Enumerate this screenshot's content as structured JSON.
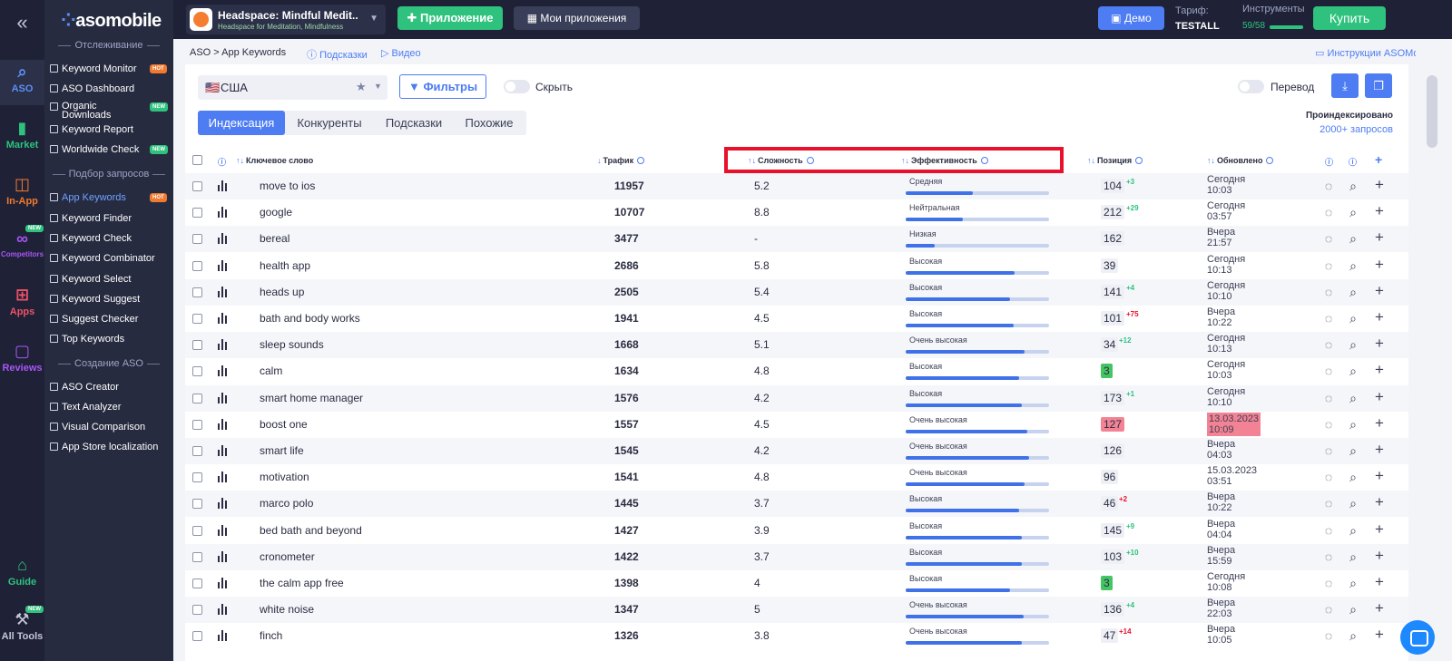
{
  "rail": {
    "items": [
      {
        "label": "ASO",
        "icon": "search-icon",
        "color": "#5b8ff7"
      },
      {
        "label": "Market",
        "icon": "bar-chart-icon",
        "color": "#2ec27e"
      },
      {
        "label": "In-App",
        "icon": "shopping-bag-icon",
        "color": "#f07a2f"
      },
      {
        "label": "Competitors",
        "icon": "binoculars-icon",
        "color": "#a855f7",
        "badge": "NEW"
      },
      {
        "label": "Apps",
        "icon": "grid-icon",
        "color": "#f0516a"
      },
      {
        "label": "Reviews",
        "icon": "chat-icon",
        "color": "#a855f7"
      },
      {
        "label": "Guide",
        "icon": "graduation-cap-icon",
        "color": "#2ec27e"
      },
      {
        "label": "All Tools",
        "icon": "tools-icon",
        "color": "#c3c7d8",
        "badge": "NEW"
      }
    ]
  },
  "sidebar": {
    "logo": "asomobile",
    "sections": [
      "Отслеживание",
      "Подбор запросов",
      "Создание ASO"
    ],
    "tracking": [
      {
        "label": "Keyword Monitor",
        "tag": "HOT"
      },
      {
        "label": "ASO Dashboard",
        "tag": ""
      },
      {
        "label": "Organic Downloads",
        "tag": "NEW"
      },
      {
        "label": "Keyword Report",
        "tag": ""
      },
      {
        "label": "Worldwide Check",
        "tag": "NEW"
      }
    ],
    "selection": [
      {
        "label": "App Keywords",
        "tag": "HOT"
      },
      {
        "label": "Keyword Finder",
        "tag": ""
      },
      {
        "label": "Keyword Check",
        "tag": ""
      },
      {
        "label": "Keyword Combinator",
        "tag": ""
      },
      {
        "label": "Keyword Select",
        "tag": ""
      },
      {
        "label": "Keyword Suggest",
        "tag": ""
      },
      {
        "label": "Suggest Checker",
        "tag": ""
      },
      {
        "label": "Top Keywords",
        "tag": ""
      }
    ],
    "creation": [
      {
        "label": "ASO Creator"
      },
      {
        "label": "Text Analyzer"
      },
      {
        "label": "Visual Comparison"
      },
      {
        "label": "App Store localization"
      }
    ]
  },
  "topbar": {
    "app_name": "Headspace: Mindful Medit...",
    "app_sub": "Headspace for Meditation, Mindfulness",
    "add_app": "Приложение",
    "my_apps": "Мои приложения",
    "demo": "Демо",
    "tariff_label": "Тариф:",
    "tariff_value": "TESTALL",
    "tools_label": "Инструменты",
    "quota": "59/58",
    "quota_fraction": 1.0,
    "buy": "Купить"
  },
  "breadcrumb": {
    "root": "ASO",
    "current": "> App Keywords",
    "hints": "Подсказки",
    "video": "Видео",
    "instructions": "Инструкции ASOMobile"
  },
  "controls": {
    "country": "США",
    "filters": "Фильтры",
    "hide": "Скрыть",
    "translate": "Перевод",
    "indexed_label": "Проиндексировано",
    "indexed_value": "2000+ запросов"
  },
  "tabs": [
    "Индексация",
    "Конкуренты",
    "Подсказки",
    "Похожие"
  ],
  "columns": {
    "keyword": "Ключевое слово",
    "traffic": "Трафик",
    "difficulty": "Сложность",
    "efficiency": "Эффективность",
    "position": "Позиция",
    "updated": "Обновлено"
  },
  "rows": [
    {
      "kw": "move to ios",
      "traffic": "11957",
      "diff": "5.2",
      "eff": "Средняя",
      "eff_level": 0.47,
      "pos": "104",
      "pos_style": "",
      "chg": "+3",
      "up": true,
      "upd1": "Сегодня",
      "upd2": "10:03",
      "upd_style": ""
    },
    {
      "kw": "google",
      "traffic": "10707",
      "diff": "8.8",
      "eff": "Нейтральная",
      "eff_level": 0.4,
      "pos": "212",
      "pos_style": "",
      "chg": "+29",
      "up": true,
      "upd1": "Сегодня",
      "upd2": "03:57",
      "upd_style": ""
    },
    {
      "kw": "bereal",
      "traffic": "3477",
      "diff": "-",
      "eff": "Низкая",
      "eff_level": 0.2,
      "pos": "162",
      "pos_style": "",
      "chg": "",
      "up": true,
      "upd1": "Вчера",
      "upd2": "21:57",
      "upd_style": ""
    },
    {
      "kw": "health app",
      "traffic": "2686",
      "diff": "5.8",
      "eff": "Высокая",
      "eff_level": 0.76,
      "pos": "39",
      "pos_style": "",
      "chg": "",
      "up": true,
      "upd1": "Сегодня",
      "upd2": "10:13",
      "upd_style": ""
    },
    {
      "kw": "heads up",
      "traffic": "2505",
      "diff": "5.4",
      "eff": "Высокая",
      "eff_level": 0.73,
      "pos": "141",
      "pos_style": "",
      "chg": "+4",
      "up": true,
      "upd1": "Сегодня",
      "upd2": "10:10",
      "upd_style": ""
    },
    {
      "kw": "bath and body works",
      "traffic": "1941",
      "diff": "4.5",
      "eff": "Высокая",
      "eff_level": 0.75,
      "pos": "101",
      "pos_style": "",
      "chg": "+75",
      "up": false,
      "upd1": "Вчера",
      "upd2": "10:22",
      "upd_style": ""
    },
    {
      "kw": "sleep sounds",
      "traffic": "1668",
      "diff": "5.1",
      "eff": "Очень высокая",
      "eff_level": 0.83,
      "pos": "34",
      "pos_style": "",
      "chg": "+12",
      "up": true,
      "upd1": "Сегодня",
      "upd2": "10:13",
      "upd_style": ""
    },
    {
      "kw": "calm",
      "traffic": "1634",
      "diff": "4.8",
      "eff": "Высокая",
      "eff_level": 0.79,
      "pos": "3",
      "pos_style": "green",
      "chg": "",
      "up": true,
      "upd1": "Сегодня",
      "upd2": "10:03",
      "upd_style": ""
    },
    {
      "kw": "smart home manager",
      "traffic": "1576",
      "diff": "4.2",
      "eff": "Высокая",
      "eff_level": 0.81,
      "pos": "173",
      "pos_style": "",
      "chg": "+1",
      "up": true,
      "upd1": "Сегодня",
      "upd2": "10:10",
      "upd_style": ""
    },
    {
      "kw": "boost one",
      "traffic": "1557",
      "diff": "4.5",
      "eff": "Очень высокая",
      "eff_level": 0.85,
      "pos": "127",
      "pos_style": "red",
      "chg": "",
      "up": true,
      "upd1": "13.03.2023",
      "upd2": "10:09",
      "upd_style": "red"
    },
    {
      "kw": "smart life",
      "traffic": "1545",
      "diff": "4.2",
      "eff": "Очень высокая",
      "eff_level": 0.86,
      "pos": "126",
      "pos_style": "",
      "chg": "",
      "up": true,
      "upd1": "Вчера",
      "upd2": "04:03",
      "upd_style": ""
    },
    {
      "kw": "motivation",
      "traffic": "1541",
      "diff": "4.8",
      "eff": "Очень высокая",
      "eff_level": 0.83,
      "pos": "96",
      "pos_style": "",
      "chg": "",
      "up": true,
      "upd1": "15.03.2023",
      "upd2": "03:51",
      "upd_style": ""
    },
    {
      "kw": "marco polo",
      "traffic": "1445",
      "diff": "3.7",
      "eff": "Высокая",
      "eff_level": 0.79,
      "pos": "46",
      "pos_style": "",
      "chg": "+2",
      "up": false,
      "upd1": "Вчера",
      "upd2": "10:22",
      "upd_style": ""
    },
    {
      "kw": "bed bath and beyond",
      "traffic": "1427",
      "diff": "3.9",
      "eff": "Высокая",
      "eff_level": 0.81,
      "pos": "145",
      "pos_style": "",
      "chg": "+9",
      "up": true,
      "upd1": "Вчера",
      "upd2": "04:04",
      "upd_style": ""
    },
    {
      "kw": "cronometer",
      "traffic": "1422",
      "diff": "3.7",
      "eff": "Высокая",
      "eff_level": 0.81,
      "pos": "103",
      "pos_style": "",
      "chg": "+10",
      "up": true,
      "upd1": "Вчера",
      "upd2": "15:59",
      "upd_style": ""
    },
    {
      "kw": "the calm app free",
      "traffic": "1398",
      "diff": "4",
      "eff": "Высокая",
      "eff_level": 0.73,
      "pos": "3",
      "pos_style": "green",
      "chg": "",
      "up": true,
      "upd1": "Сегодня",
      "upd2": "10:08",
      "upd_style": ""
    },
    {
      "kw": "white noise",
      "traffic": "1347",
      "diff": "5",
      "eff": "Очень высокая",
      "eff_level": 0.82,
      "pos": "136",
      "pos_style": "",
      "chg": "+4",
      "up": true,
      "upd1": "Вчера",
      "upd2": "22:03",
      "upd_style": ""
    },
    {
      "kw": "finch",
      "traffic": "1326",
      "diff": "3.8",
      "eff": "Очень высокая",
      "eff_level": 0.81,
      "pos": "47",
      "pos_style": "",
      "chg": "+14",
      "up": false,
      "upd1": "Вчера",
      "upd2": "10:05",
      "upd_style": ""
    }
  ],
  "colors": {
    "accent": "#4d7cf3",
    "green": "#2ec27e",
    "highlight": "#e8102b"
  }
}
